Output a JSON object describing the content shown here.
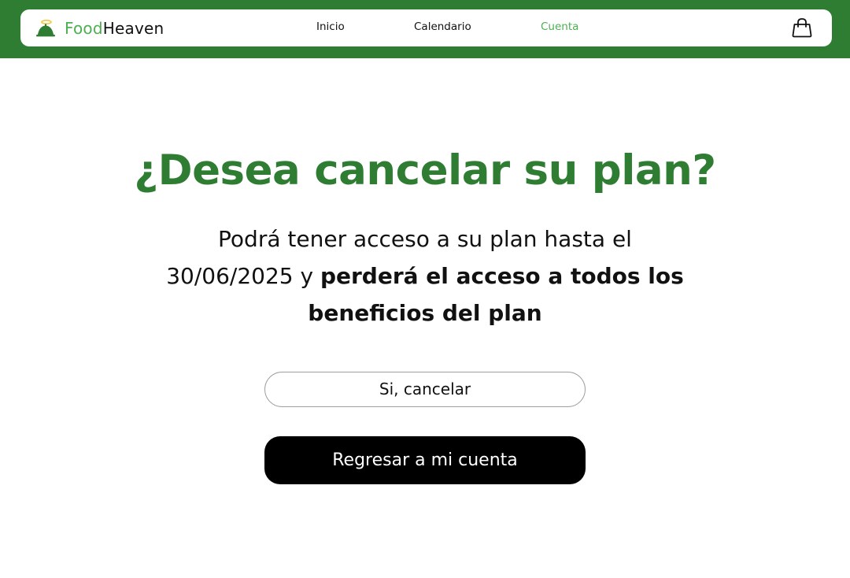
{
  "brand": {
    "name_part1": "Food",
    "name_part2": "Heaven",
    "icon": "cloche-halo-icon"
  },
  "nav": {
    "items": [
      {
        "label": "Inicio",
        "active": false
      },
      {
        "label": "Calendario",
        "active": false
      },
      {
        "label": "Cuenta",
        "active": true
      }
    ],
    "cart_icon": "shopping-bag-icon"
  },
  "main": {
    "title": "¿Desea cancelar su plan?",
    "message_line1": "Podrá tener acceso a su plan hasta el",
    "message_date_prefix": "30/06/2025 y ",
    "message_bold": "perderá el acceso a todos los beneficios del plan",
    "cancel_button": "Si, cancelar",
    "back_button": "Regresar a mi cuenta"
  },
  "colors": {
    "brand_green": "#2e7d32",
    "accent_green": "#4caf50",
    "primary_button": "#000000",
    "text": "#111111"
  }
}
